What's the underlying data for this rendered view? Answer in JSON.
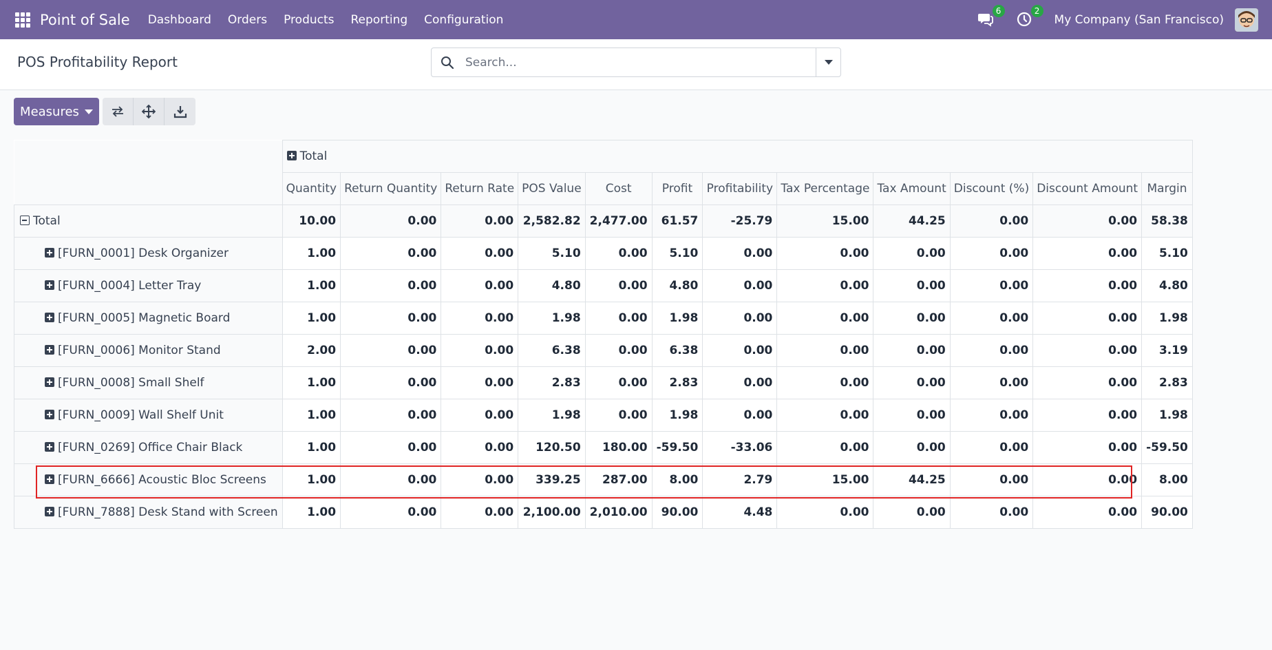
{
  "navbar": {
    "app_name": "Point of Sale",
    "menu": [
      "Dashboard",
      "Orders",
      "Products",
      "Reporting",
      "Configuration"
    ],
    "messages_count": "6",
    "activities_count": "2",
    "company": "My Company (San Francisco)",
    "brand_color": "#71639e"
  },
  "control_panel": {
    "title": "POS Profitability Report",
    "search_placeholder": "Search..."
  },
  "toolbar": {
    "measures_label": "Measures",
    "icons": [
      "flip-axis-icon",
      "expand-all-icon",
      "download-icon"
    ]
  },
  "pivot": {
    "col_header_total": "Total",
    "measures": [
      "Quantity",
      "Return Quantity",
      "Return Rate",
      "POS Value",
      "Cost",
      "Profit",
      "Profitability",
      "Tax Percentage",
      "Tax Amount",
      "Discount (%)",
      "Discount Amount",
      "Margin"
    ],
    "total_row": {
      "label": "Total",
      "values": [
        "10.00",
        "0.00",
        "0.00",
        "2,582.82",
        "2,477.00",
        "61.57",
        "-25.79",
        "15.00",
        "44.25",
        "0.00",
        "0.00",
        "58.38"
      ]
    },
    "rows": [
      {
        "label": "[FURN_0001] Desk Organizer",
        "values": [
          "1.00",
          "0.00",
          "0.00",
          "5.10",
          "0.00",
          "5.10",
          "0.00",
          "0.00",
          "0.00",
          "0.00",
          "0.00",
          "5.10"
        ]
      },
      {
        "label": "[FURN_0004] Letter Tray",
        "values": [
          "1.00",
          "0.00",
          "0.00",
          "4.80",
          "0.00",
          "4.80",
          "0.00",
          "0.00",
          "0.00",
          "0.00",
          "0.00",
          "4.80"
        ]
      },
      {
        "label": "[FURN_0005] Magnetic Board",
        "values": [
          "1.00",
          "0.00",
          "0.00",
          "1.98",
          "0.00",
          "1.98",
          "0.00",
          "0.00",
          "0.00",
          "0.00",
          "0.00",
          "1.98"
        ]
      },
      {
        "label": "[FURN_0006] Monitor Stand",
        "values": [
          "2.00",
          "0.00",
          "0.00",
          "6.38",
          "0.00",
          "6.38",
          "0.00",
          "0.00",
          "0.00",
          "0.00",
          "0.00",
          "3.19"
        ]
      },
      {
        "label": "[FURN_0008] Small Shelf",
        "values": [
          "1.00",
          "0.00",
          "0.00",
          "2.83",
          "0.00",
          "2.83",
          "0.00",
          "0.00",
          "0.00",
          "0.00",
          "0.00",
          "2.83"
        ]
      },
      {
        "label": "[FURN_0009] Wall Shelf Unit",
        "values": [
          "1.00",
          "0.00",
          "0.00",
          "1.98",
          "0.00",
          "1.98",
          "0.00",
          "0.00",
          "0.00",
          "0.00",
          "0.00",
          "1.98"
        ]
      },
      {
        "label": "[FURN_0269] Office Chair Black",
        "values": [
          "1.00",
          "0.00",
          "0.00",
          "120.50",
          "180.00",
          "-59.50",
          "-33.06",
          "0.00",
          "0.00",
          "0.00",
          "0.00",
          "-59.50"
        ]
      },
      {
        "label": "[FURN_6666] Acoustic Bloc Screens",
        "values": [
          "1.00",
          "0.00",
          "0.00",
          "339.25",
          "287.00",
          "8.00",
          "2.79",
          "15.00",
          "44.25",
          "0.00",
          "0.00",
          "8.00"
        ]
      },
      {
        "label": "[FURN_7888] Desk Stand with Screen",
        "values": [
          "1.00",
          "0.00",
          "0.00",
          "2,100.00",
          "2,010.00",
          "90.00",
          "4.48",
          "0.00",
          "0.00",
          "0.00",
          "0.00",
          "90.00"
        ]
      }
    ]
  },
  "highlight_color": "#e02424"
}
